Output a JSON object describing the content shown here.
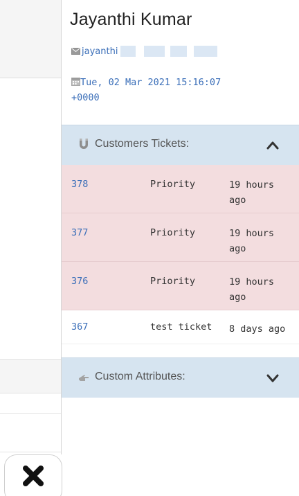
{
  "customer": {
    "name": "Jayanthi Kumar",
    "email": "jayanthi",
    "created_line1": "Tue, 02 Mar 2021 15:16:07",
    "created_line2": "+0000"
  },
  "tickets_section": {
    "title": "Customers Tickets:",
    "expanded": true,
    "icon": "magnet-icon",
    "rows": [
      {
        "id": "378",
        "title": "Priority",
        "age_line1": "19 hours",
        "age_line2": "ago",
        "highlight": true
      },
      {
        "id": "377",
        "title": "Priority",
        "age_line1": "19 hours",
        "age_line2": "ago",
        "highlight": true
      },
      {
        "id": "376",
        "title": "Priority",
        "age_line1": "19 hours",
        "age_line2": "ago",
        "highlight": true
      },
      {
        "id": "367",
        "title": "test ticket",
        "age_line1": "8 days ago",
        "age_line2": "",
        "highlight": false
      }
    ]
  },
  "attributes_section": {
    "title": "Custom Attributes:",
    "expanded": false,
    "icon": "hand-pointer-icon"
  },
  "colors": {
    "link": "#3a6eb8",
    "section_bg": "#d6e4f0",
    "priority_row_bg": "#f3dddf"
  },
  "close_icon": "close-icon"
}
